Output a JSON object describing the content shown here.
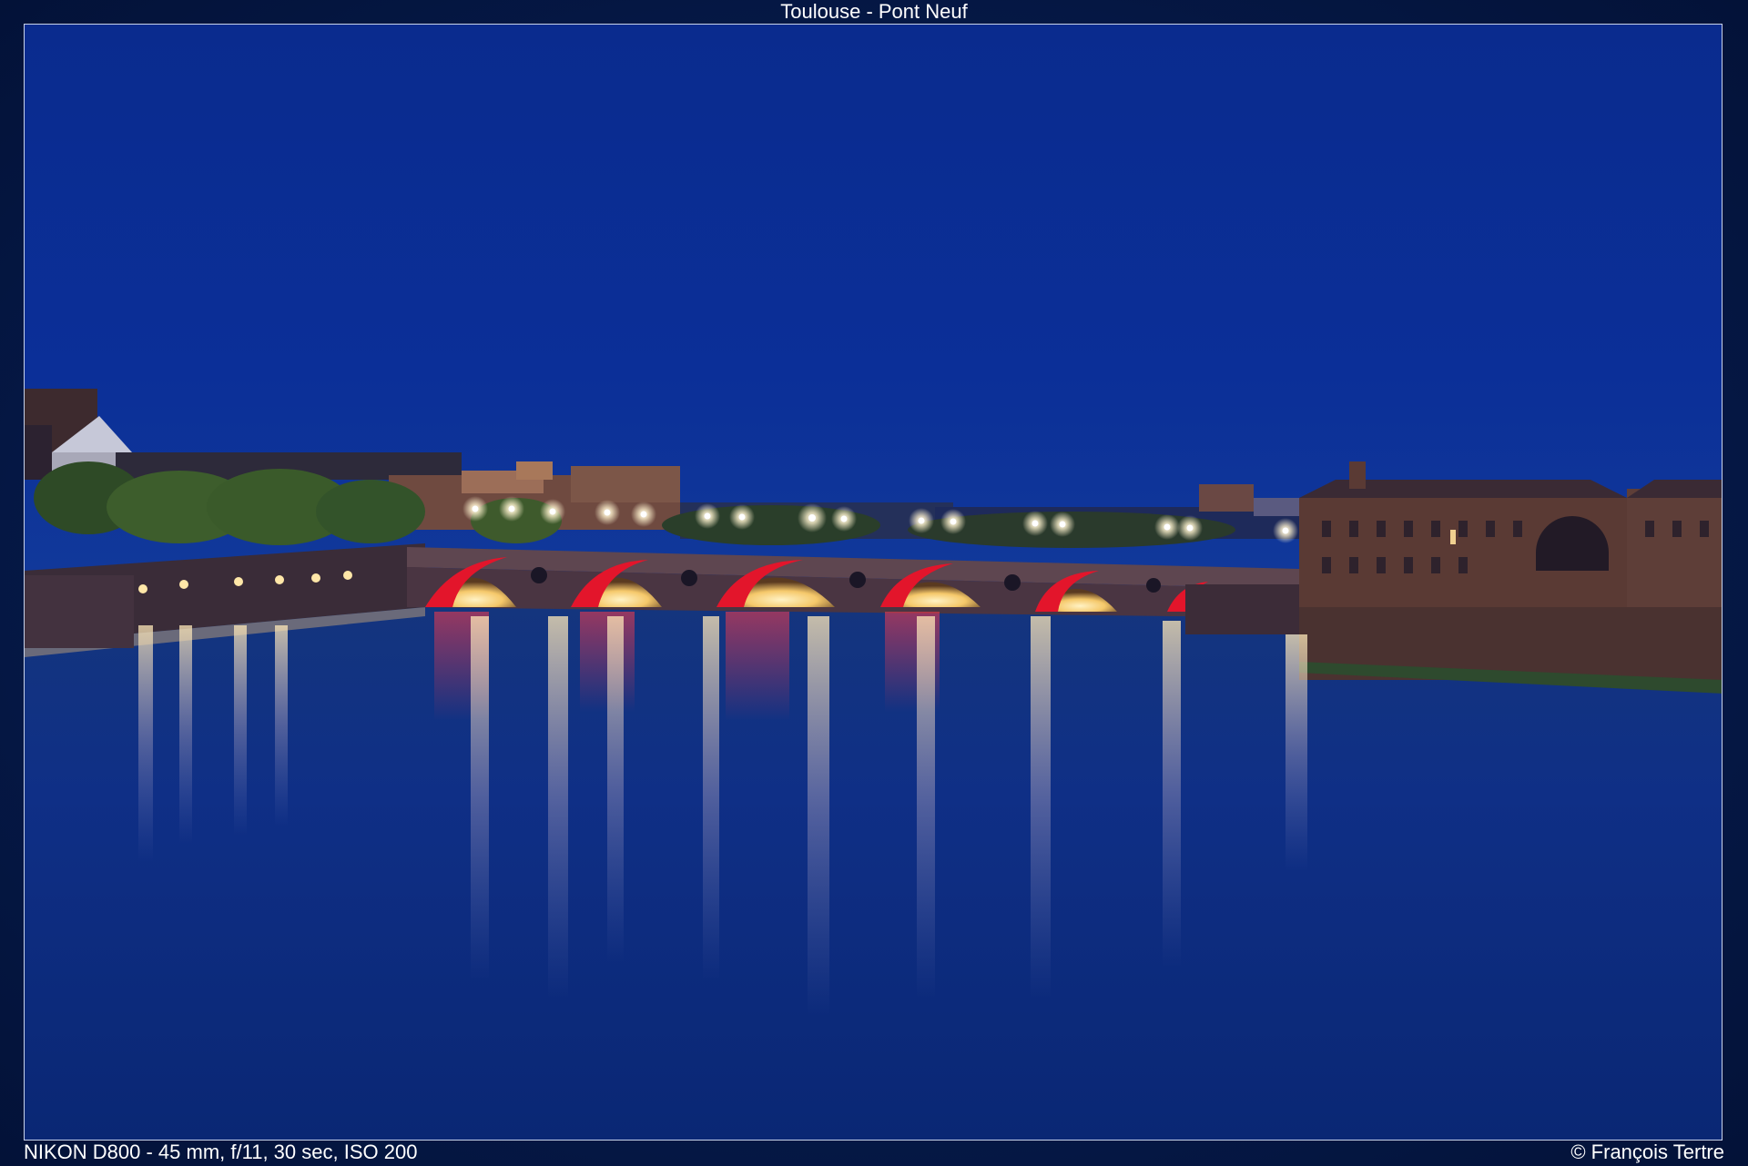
{
  "title": "Toulouse - Pont Neuf",
  "camera_info": "NIKON D800 - 45 mm, f/11, 30 sec, ISO 200",
  "copyright": "© François Tertre",
  "photo": {
    "subject": "Pont Neuf bridge at night",
    "sky_color": "#0a2a8c",
    "water_color": "#0d2d82",
    "arch_light_color": "#e3152b",
    "lamp_color": "#fff6d8"
  }
}
